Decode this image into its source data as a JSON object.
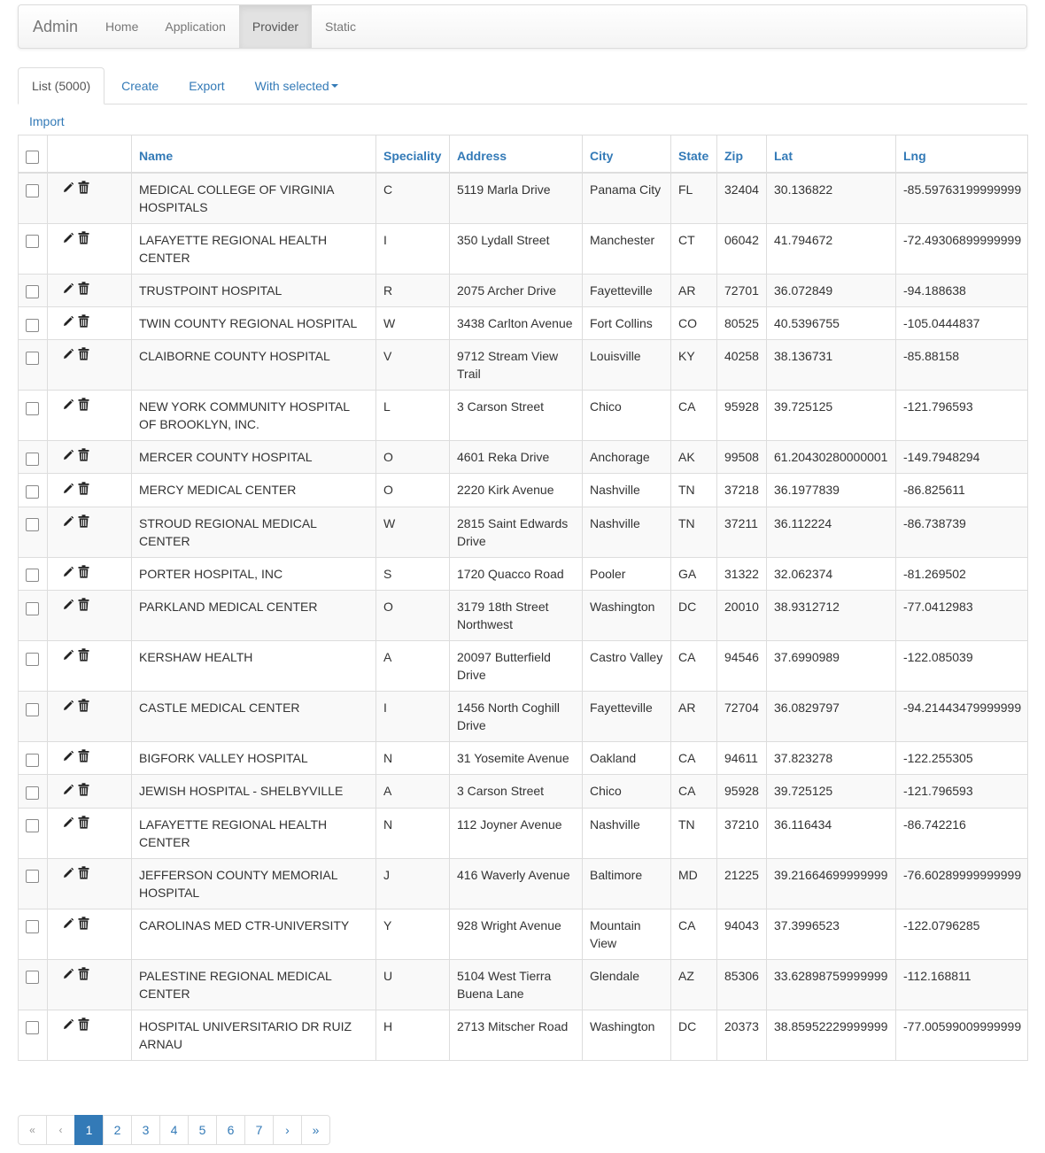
{
  "navbar": {
    "brand": "Admin",
    "items": [
      {
        "label": "Home"
      },
      {
        "label": "Application"
      },
      {
        "label": "Provider",
        "active": true
      },
      {
        "label": "Static"
      }
    ]
  },
  "tabs": {
    "list": "List (5000)",
    "create": "Create",
    "export": "Export",
    "with_selected": "With selected",
    "import": "Import"
  },
  "table": {
    "headers": {
      "name": "Name",
      "speciality": "Speciality",
      "address": "Address",
      "city": "City",
      "state": "State",
      "zip": "Zip",
      "lat": "Lat",
      "lng": "Lng"
    },
    "rows": [
      {
        "name": "MEDICAL COLLEGE OF VIRGINIA HOSPITALS",
        "speciality": "C",
        "address": "5119 Marla Drive",
        "city": "Panama City",
        "state": "FL",
        "zip": "32404",
        "lat": "30.136822",
        "lng": "-85.59763199999999"
      },
      {
        "name": "LAFAYETTE REGIONAL HEALTH CENTER",
        "speciality": "I",
        "address": "350 Lydall Street",
        "city": "Manchester",
        "state": "CT",
        "zip": "06042",
        "lat": "41.794672",
        "lng": "-72.49306899999999"
      },
      {
        "name": "TRUSTPOINT HOSPITAL",
        "speciality": "R",
        "address": "2075 Archer Drive",
        "city": "Fayetteville",
        "state": "AR",
        "zip": "72701",
        "lat": "36.072849",
        "lng": "-94.188638"
      },
      {
        "name": "TWIN COUNTY REGIONAL HOSPITAL",
        "speciality": "W",
        "address": "3438 Carlton Avenue",
        "city": "Fort Collins",
        "state": "CO",
        "zip": "80525",
        "lat": "40.5396755",
        "lng": "-105.0444837"
      },
      {
        "name": "CLAIBORNE COUNTY HOSPITAL",
        "speciality": "V",
        "address": "9712 Stream View Trail",
        "city": "Louisville",
        "state": "KY",
        "zip": "40258",
        "lat": "38.136731",
        "lng": "-85.88158"
      },
      {
        "name": "NEW YORK COMMUNITY HOSPITAL OF BROOKLYN, INC.",
        "speciality": "L",
        "address": "3 Carson Street",
        "city": "Chico",
        "state": "CA",
        "zip": "95928",
        "lat": "39.725125",
        "lng": "-121.796593"
      },
      {
        "name": "MERCER COUNTY HOSPITAL",
        "speciality": "O",
        "address": "4601 Reka Drive",
        "city": "Anchorage",
        "state": "AK",
        "zip": "99508",
        "lat": "61.20430280000001",
        "lng": "-149.7948294"
      },
      {
        "name": "MERCY MEDICAL CENTER",
        "speciality": "O",
        "address": "2220 Kirk Avenue",
        "city": "Nashville",
        "state": "TN",
        "zip": "37218",
        "lat": "36.1977839",
        "lng": "-86.825611"
      },
      {
        "name": "STROUD REGIONAL MEDICAL CENTER",
        "speciality": "W",
        "address": "2815 Saint Edwards Drive",
        "city": "Nashville",
        "state": "TN",
        "zip": "37211",
        "lat": "36.112224",
        "lng": "-86.738739"
      },
      {
        "name": "PORTER HOSPITAL, INC",
        "speciality": "S",
        "address": "1720 Quacco Road",
        "city": "Pooler",
        "state": "GA",
        "zip": "31322",
        "lat": "32.062374",
        "lng": "-81.269502"
      },
      {
        "name": "PARKLAND MEDICAL CENTER",
        "speciality": "O",
        "address": "3179 18th Street Northwest",
        "city": "Washington",
        "state": "DC",
        "zip": "20010",
        "lat": "38.9312712",
        "lng": "-77.0412983"
      },
      {
        "name": "KERSHAW HEALTH",
        "speciality": "A",
        "address": "20097 Butterfield Drive",
        "city": "Castro Valley",
        "state": "CA",
        "zip": "94546",
        "lat": "37.6990989",
        "lng": "-122.085039"
      },
      {
        "name": "CASTLE MEDICAL CENTER",
        "speciality": "I",
        "address": "1456 North Coghill Drive",
        "city": "Fayetteville",
        "state": "AR",
        "zip": "72704",
        "lat": "36.0829797",
        "lng": "-94.21443479999999"
      },
      {
        "name": "BIGFORK VALLEY HOSPITAL",
        "speciality": "N",
        "address": "31 Yosemite Avenue",
        "city": "Oakland",
        "state": "CA",
        "zip": "94611",
        "lat": "37.823278",
        "lng": "-122.255305"
      },
      {
        "name": "JEWISH HOSPITAL - SHELBYVILLE",
        "speciality": "A",
        "address": "3 Carson Street",
        "city": "Chico",
        "state": "CA",
        "zip": "95928",
        "lat": "39.725125",
        "lng": "-121.796593"
      },
      {
        "name": "LAFAYETTE REGIONAL HEALTH CENTER",
        "speciality": "N",
        "address": "112 Joyner Avenue",
        "city": "Nashville",
        "state": "TN",
        "zip": "37210",
        "lat": "36.116434",
        "lng": "-86.742216"
      },
      {
        "name": "JEFFERSON COUNTY MEMORIAL HOSPITAL",
        "speciality": "J",
        "address": "416 Waverly Avenue",
        "city": "Baltimore",
        "state": "MD",
        "zip": "21225",
        "lat": "39.21664699999999",
        "lng": "-76.60289999999999"
      },
      {
        "name": "CAROLINAS MED CTR-UNIVERSITY",
        "speciality": "Y",
        "address": "928 Wright Avenue",
        "city": "Mountain View",
        "state": "CA",
        "zip": "94043",
        "lat": "37.3996523",
        "lng": "-122.0796285"
      },
      {
        "name": "PALESTINE REGIONAL MEDICAL CENTER",
        "speciality": "U",
        "address": "5104 West Tierra Buena Lane",
        "city": "Glendale",
        "state": "AZ",
        "zip": "85306",
        "lat": "33.62898759999999",
        "lng": "-112.168811"
      },
      {
        "name": "HOSPITAL UNIVERSITARIO DR RUIZ ARNAU",
        "speciality": "H",
        "address": "2713 Mitscher Road",
        "city": "Washington",
        "state": "DC",
        "zip": "20373",
        "lat": "38.85952229999999",
        "lng": "-77.00599009999999"
      }
    ],
    "row_icons": [
      "pencil-icon",
      "trash-icon"
    ]
  },
  "pagination": {
    "first": "«",
    "prev": "‹",
    "pages": [
      "1",
      "2",
      "3",
      "4",
      "5",
      "6",
      "7"
    ],
    "current": "1",
    "next": "›",
    "last": "»"
  },
  "colors": {
    "link": "#337ab7",
    "nav_active_bg": "#e2e2e2",
    "stripe": "#f9f9f9",
    "border": "#dddddd"
  }
}
